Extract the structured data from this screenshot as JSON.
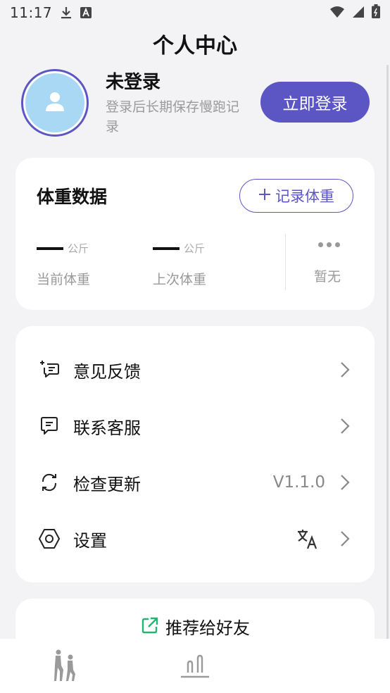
{
  "status_bar": {
    "time": "11:17",
    "left_icons": [
      "download-icon",
      "text-a-icon"
    ],
    "right_icons": [
      "wifi-icon",
      "signal-icon",
      "battery-icon"
    ]
  },
  "header": {
    "title": "个人中心"
  },
  "profile": {
    "name": "未登录",
    "description": "登录后长期保存慢跑记录",
    "login_button": "立即登录",
    "avatar_icon": "user-icon"
  },
  "weight": {
    "title": "体重数据",
    "record_button": "记录体重",
    "record_icon": "plus-icon",
    "current": {
      "value": "—",
      "unit": "公斤",
      "label": "当前体重"
    },
    "previous": {
      "value": "—",
      "unit": "公斤",
      "label": "上次体重"
    },
    "more_icon": "more-dots-icon",
    "none_label": "暂无"
  },
  "menu": {
    "items": [
      {
        "label": "意见反馈",
        "icon": "feedback-icon"
      },
      {
        "label": "联系客服",
        "icon": "chat-icon"
      },
      {
        "label": "检查更新",
        "icon": "refresh-icon",
        "value": "V1.1.0"
      },
      {
        "label": "设置",
        "icon": "settings-icon",
        "extra_icon": "translate-icon"
      }
    ]
  },
  "share": {
    "label": "推荐给好友",
    "icon": "share-icon"
  },
  "bottom_nav": {
    "tabs": [
      {
        "icon": "runners-icon",
        "active": true
      },
      {
        "icon": "chart-icon",
        "active": false
      }
    ]
  },
  "colors": {
    "accent": "#5b56c4",
    "avatar_bg": "#a9d8f5",
    "share_icon": "#22b573",
    "background": "#f3f3f6",
    "card": "#ffffff"
  }
}
